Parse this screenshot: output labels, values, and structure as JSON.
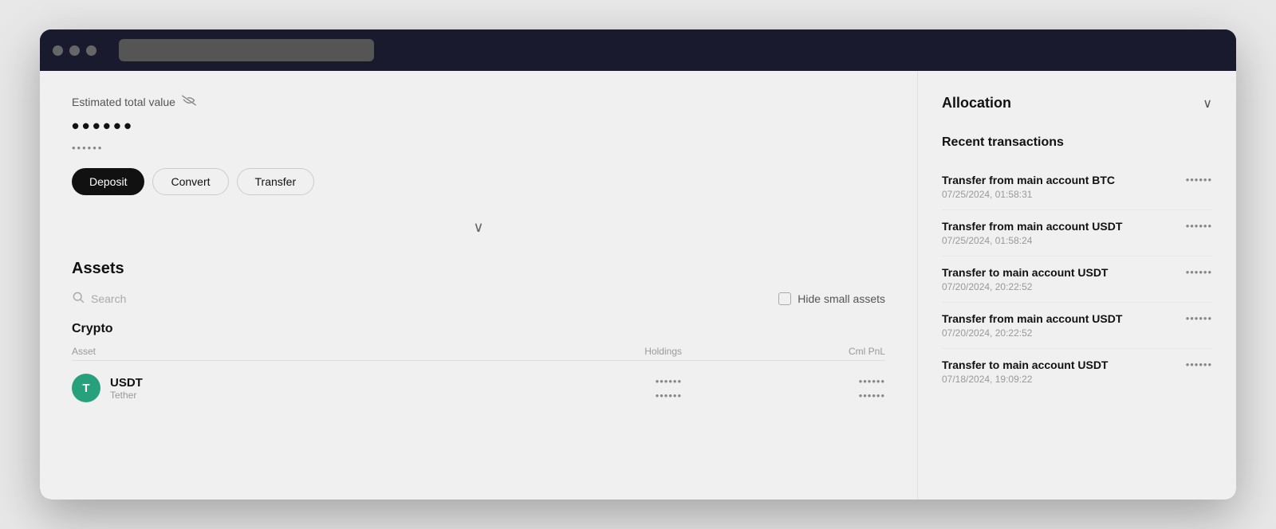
{
  "browser": {
    "title": ""
  },
  "header": {
    "estimated_label": "Estimated total value",
    "masked_value_large": "••••••",
    "masked_value_small": "••••••"
  },
  "actions": {
    "deposit": "Deposit",
    "convert": "Convert",
    "transfer": "Transfer"
  },
  "assets": {
    "title": "Assets",
    "search_placeholder": "Search",
    "hide_small_label": "Hide small assets",
    "crypto_label": "Crypto",
    "table_headers": {
      "asset": "Asset",
      "holdings": "Holdings",
      "cml_pnl": "Cml PnL"
    },
    "rows": [
      {
        "icon_letter": "T",
        "name": "USDT",
        "sub": "Tether",
        "holdings_1": "••••••",
        "holdings_2": "••••••",
        "pnl_1": "••••••",
        "pnl_2": "••••••"
      }
    ]
  },
  "allocation": {
    "title": "Allocation",
    "chevron": "∨"
  },
  "recent_transactions": {
    "title": "Recent transactions",
    "items": [
      {
        "name": "Transfer from main account BTC",
        "date": "07/25/2024, 01:58:31",
        "amount": "••••••"
      },
      {
        "name": "Transfer from main account USDT",
        "date": "07/25/2024, 01:58:24",
        "amount": "••••••"
      },
      {
        "name": "Transfer to main account USDT",
        "date": "07/20/2024, 20:22:52",
        "amount": "••••••"
      },
      {
        "name": "Transfer from main account USDT",
        "date": "07/20/2024, 20:22:52",
        "amount": "••••••"
      },
      {
        "name": "Transfer to main account USDT",
        "date": "07/18/2024, 19:09:22",
        "amount": "••••••"
      }
    ]
  }
}
